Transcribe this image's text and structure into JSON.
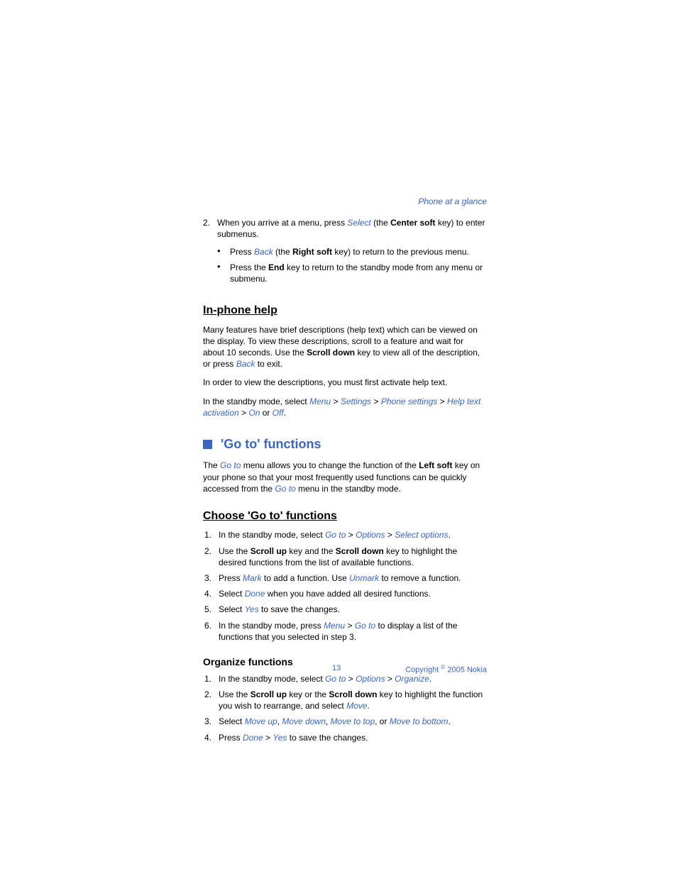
{
  "header_link": "Phone at a glance",
  "top_list": {
    "num2": "2.",
    "item2_pre": "When you arrive at a menu, press ",
    "item2_select": "Select",
    "item2_mid": " (the ",
    "item2_centersoft": "Center soft",
    "item2_post": " key) to enter submenus.",
    "bullet1_pre": "Press ",
    "bullet1_back": "Back",
    "bullet1_mid": " (the ",
    "bullet1_rightsoft": "Right soft",
    "bullet1_post": " key) to return to the previous menu.",
    "bullet2_pre": "Press the ",
    "bullet2_end": "End",
    "bullet2_post": " key to return to the standby mode from any menu or submenu."
  },
  "inphone": {
    "heading": "In-phone help",
    "para1_a": "Many features have brief descriptions (help text) which can be viewed on the display. To view these descriptions, scroll to a feature and wait for about 10 seconds. Use the ",
    "para1_scroll": "Scroll down",
    "para1_b": " key to view all of the description, or press ",
    "para1_back": "Back",
    "para1_c": " to exit.",
    "para2": "In order to view the descriptions, you must first activate help text.",
    "para3_a": "In the standby mode, select ",
    "para3_menu": "Menu",
    "gt": " > ",
    "para3_settings": "Settings",
    "para3_phone": "Phone settings",
    "para3_help": "Help text activation",
    "para3_on": "On",
    "para3_or": " or ",
    "para3_off": "Off",
    "period": "."
  },
  "goto": {
    "heading": " 'Go to' functions",
    "intro_a": "The ",
    "intro_goto": "Go to",
    "intro_b": " menu allows you to change the function of the ",
    "intro_leftsoft": "Left soft",
    "intro_c": " key on your phone so that your most frequently used functions can be quickly accessed from the ",
    "intro_d": " menu in the standby mode."
  },
  "choose": {
    "heading": "Choose 'Go to' functions",
    "n1": "1.",
    "n2": "2.",
    "n3": "3.",
    "n4": "4.",
    "n5": "5.",
    "n6": "6.",
    "i1_a": "In the standby mode, select ",
    "i1_goto": "Go to",
    "gt": " > ",
    "i1_options": "Options",
    "i1_selectopt": "Select options",
    "period": ".",
    "i2_a": "Use the ",
    "i2_scrollup": "Scroll up",
    "i2_b": " key and the ",
    "i2_scrolldown": "Scroll down",
    "i2_c": " key to highlight the desired functions from the list of available functions.",
    "i3_a": "Press ",
    "i3_mark": "Mark",
    "i3_b": " to add a function. Use ",
    "i3_unmark": "Unmark",
    "i3_c": " to remove a function.",
    "i4_a": "Select ",
    "i4_done": "Done",
    "i4_b": " when you have added all desired functions.",
    "i5_a": "Select ",
    "i5_yes": "Yes",
    "i5_b": " to save the changes.",
    "i6_a": "In the standby mode, press ",
    "i6_menu": "Menu",
    "i6_goto": "Go to",
    "i6_b": " to display a list of the functions that you selected in step 3."
  },
  "organize": {
    "heading": "Organize functions",
    "n1": "1.",
    "n2": "2.",
    "n3": "3.",
    "n4": "4.",
    "i1_a": "In the standby mode, select ",
    "i1_goto": "Go to ",
    "gt": " > ",
    "i1_options": "Options",
    "i1_organize": "Organize",
    "period": ".",
    "i2_a": "Use the ",
    "i2_scrollup": "Scroll up",
    "i2_b": " key or the ",
    "i2_scrolldown": "Scroll down",
    "i2_c": " key to highlight the function you wish to rearrange, and select ",
    "i2_move": "Move",
    "i3_a": "Select ",
    "i3_moveup": "Move up",
    "comma": ", ",
    "i3_movedown": "Move down",
    "i3_movetop": "Move to top",
    "i3_or": ", or ",
    "i3_movebottom": "Move to bottom",
    "i4_a": "Press ",
    "i4_done": "Done",
    "i4_yes": "Yes",
    "i4_b": " to save the changes."
  },
  "footer": {
    "pagenum": "13",
    "copyright_a": "Copyright ",
    "copyright_sym": "©",
    "copyright_b": " 2005 Nokia"
  }
}
